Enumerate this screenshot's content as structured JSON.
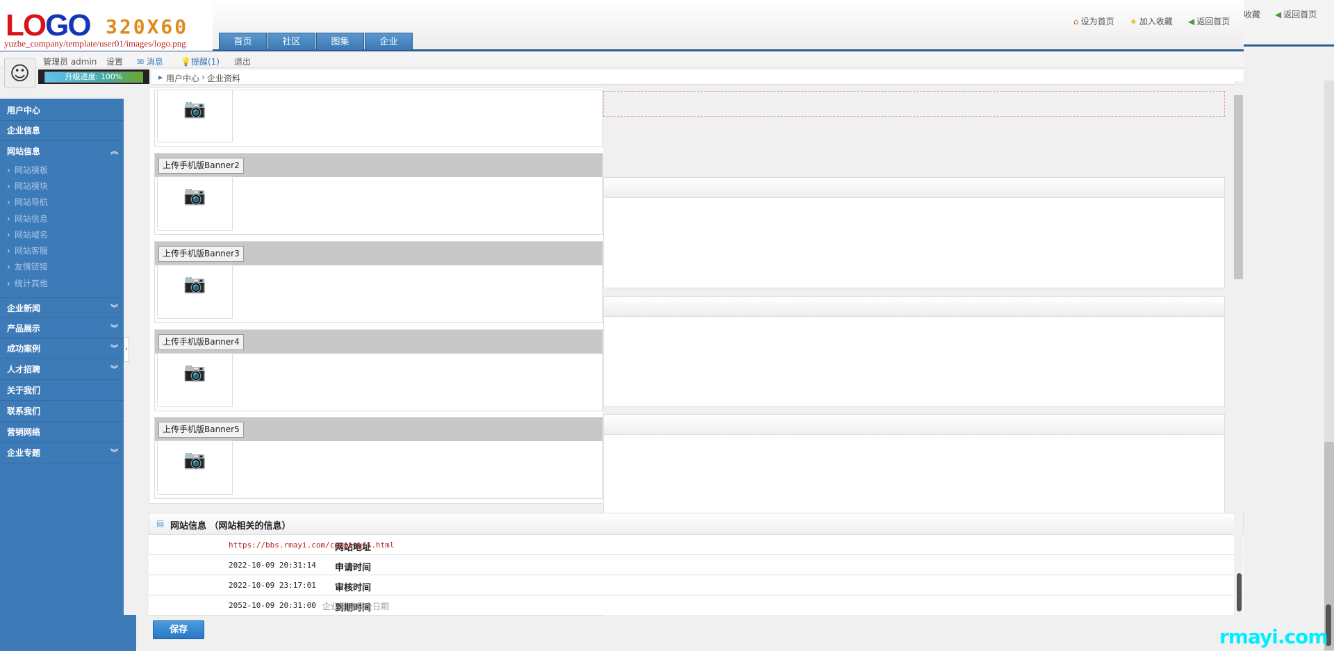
{
  "logo": {
    "text": "LOGO",
    "size": "320X60",
    "path": "yuzhe_company/template/user01/images/logo.png"
  },
  "nav": [
    "首页",
    "社区",
    "图集",
    "企业"
  ],
  "top_links": [
    {
      "icon": "home-icon",
      "label": "设为首页"
    },
    {
      "icon": "star-icon",
      "label": "加入收藏"
    },
    {
      "icon": "back-arrow-icon",
      "label": "返回首页"
    }
  ],
  "top_links_dup": {
    "fav": "收藏",
    "home": "返回首页"
  },
  "userbar": {
    "user": "管理员 admin",
    "settings": "设置",
    "messages": "消息",
    "reminders": "提醒(1)",
    "logout": "退出"
  },
  "progress": {
    "label": "升级进度: 100%",
    "value": 100
  },
  "breadcrumb": [
    "用户中心",
    "企业资料"
  ],
  "sidebar": {
    "items": [
      {
        "label": "用户中心"
      },
      {
        "label": "企业信息"
      },
      {
        "label": "网站信息",
        "expanded": true,
        "children": [
          "网站模板",
          "网站模块",
          "网站导航",
          "网站信息",
          "网站域名",
          "网站客服",
          "友情链接",
          "统计其他"
        ]
      },
      {
        "label": "企业新闻",
        "collapsible": true
      },
      {
        "label": "产品展示",
        "collapsible": true
      },
      {
        "label": "成功案例",
        "collapsible": true
      },
      {
        "label": "人才招聘",
        "collapsible": true
      },
      {
        "label": "关于我们"
      },
      {
        "label": "联系我们"
      },
      {
        "label": "营销网络"
      },
      {
        "label": "企业专题",
        "collapsible": true
      }
    ]
  },
  "banners": [
    "上传手机版Banner2",
    "上传手机版Banner3",
    "上传手机版Banner4",
    "上传手机版Banner5"
  ],
  "site_info": {
    "title": "网站信息 （网站相关的信息）",
    "rows": [
      {
        "label": "网站地址",
        "value": "https://bbs.rmayi.com/company/1.html",
        "color": "#b22222"
      },
      {
        "label": "申请时间",
        "value": "2022-10-09 20:31:14"
      },
      {
        "label": "审核时间",
        "value": "2022-10-09 23:17:01"
      },
      {
        "label": "到期时间",
        "value": "2052-10-09 20:31:00",
        "note": "企业网站截止日期"
      }
    ]
  },
  "save_label": "保存",
  "watermark": "rmayi.com",
  "colors": {
    "sidebar": "#3d7ab8",
    "nav": "#3b78b3",
    "accent": "#2d5d8f"
  }
}
